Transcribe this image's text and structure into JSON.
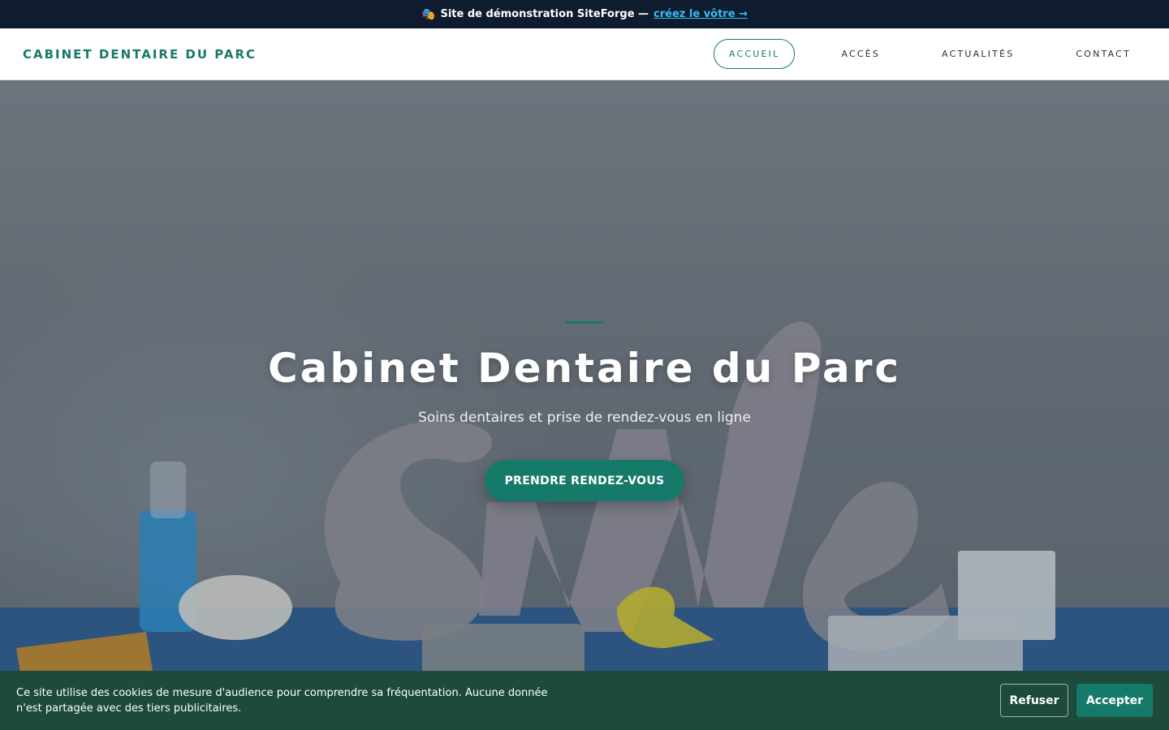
{
  "demo_banner": {
    "icon": "theater-masks-icon",
    "text": "Site de démonstration SiteForge —",
    "link_label": "créez le vôtre →",
    "link_color": "#38bdf8"
  },
  "header": {
    "brand": "CABINET DENTAIRE DU PARC",
    "nav": [
      {
        "label": "ACCUEIL",
        "active": true
      },
      {
        "label": "ACCÈS",
        "active": false
      },
      {
        "label": "ACTUALITÉS",
        "active": false
      },
      {
        "label": "CONTACT",
        "active": false
      }
    ]
  },
  "hero": {
    "title": "Cabinet Dentaire du Parc",
    "subtitle": "Soins dentaires et prise de rendez-vous en ligne",
    "cta_label": "PRENDRE RENDEZ-VOUS"
  },
  "cookie_banner": {
    "text": "Ce site utilise des cookies de mesure d'audience pour comprendre sa fréquentation. Aucune donnée n'est partagée avec des tiers publicitaires.",
    "refuse_label": "Refuser",
    "accept_label": "Accepter"
  },
  "colors": {
    "brand": "#167a6a",
    "demo_bar": "#0f1b2e",
    "cookie_bar": "#1d4a3b"
  }
}
